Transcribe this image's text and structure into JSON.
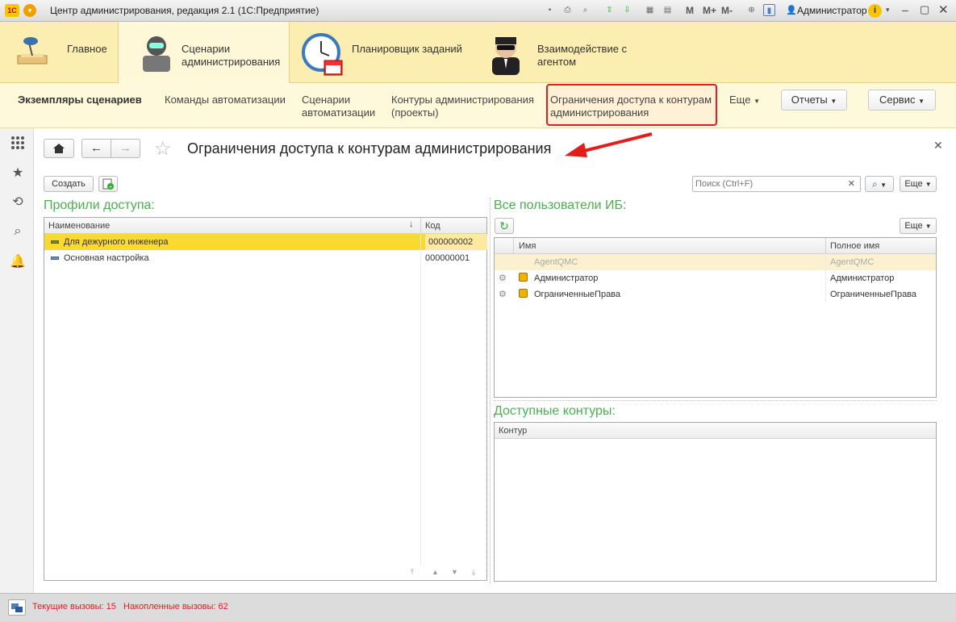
{
  "window": {
    "title": "Центр администрирования, редакция 2.1 (1С:Предприятие)",
    "user": "Администратор",
    "m_labels": [
      "M",
      "M+",
      "M-"
    ]
  },
  "sections": [
    {
      "label": "Главное"
    },
    {
      "label": "Сценарии администрирования"
    },
    {
      "label": "Планировщик заданий"
    },
    {
      "label": "Взаимодействие с агентом"
    }
  ],
  "nav": {
    "items": [
      "Экземпляры сценариев",
      "Команды автоматизации",
      "Сценарии автоматизации",
      "Контуры администрирования (проекты)",
      "Ограничения доступа к контурам администрирования"
    ],
    "more": "Еще",
    "reports": "Отчеты",
    "service": "Сервис"
  },
  "form": {
    "title": "Ограничения доступа к контурам администрирования",
    "create": "Создать",
    "search_placeholder": "Поиск (Ctrl+F)",
    "more": "Еще"
  },
  "profiles": {
    "heading": "Профили доступа:",
    "columns": [
      "Наименование",
      "Код"
    ],
    "rows": [
      {
        "name": "Для дежурного инженера",
        "code": "000000002"
      },
      {
        "name": "Основная настройка",
        "code": "000000001"
      }
    ]
  },
  "users": {
    "heading": "Все пользователи ИБ:",
    "more": "Еще",
    "columns": [
      "Имя",
      "Полное имя"
    ],
    "rows": [
      {
        "name": "AgentQMC",
        "full": "AgentQMC"
      },
      {
        "name": "Администратор",
        "full": "Администратор"
      },
      {
        "name": "ОграниченныеПрава",
        "full": "ОграниченныеПрава"
      }
    ]
  },
  "contours": {
    "heading": "Доступные контуры:",
    "column": "Контур"
  },
  "status": {
    "current": "Текущие вызовы: 15",
    "accumulated": "Накопленные вызовы: 62"
  }
}
